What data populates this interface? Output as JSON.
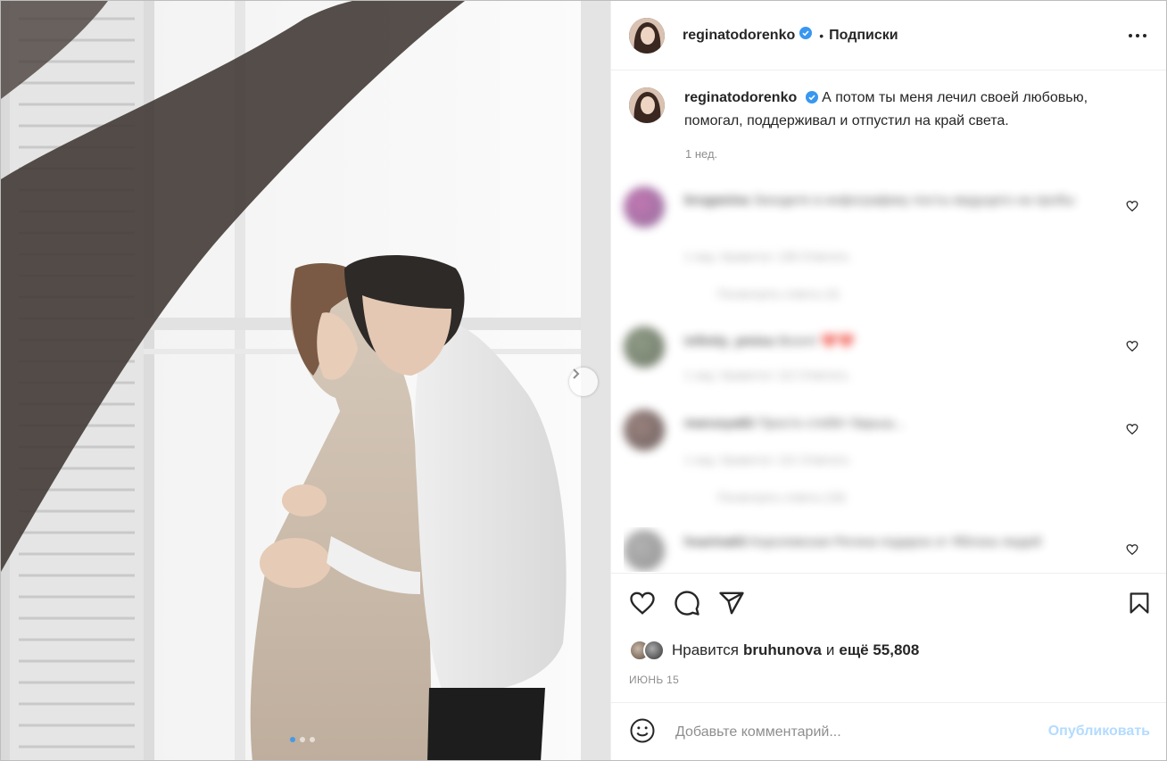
{
  "post": {
    "image_alt": "photo",
    "carousel": {
      "count": 3,
      "active_index": 0
    }
  },
  "header": {
    "username": "reginatodorenko",
    "separator": "•",
    "follow_label": "Подписки"
  },
  "caption": {
    "username": "reginatodorenko",
    "text": "А потом ты меня лечил своей любовью, помогал, поддерживал и отпустил на край света.",
    "time": "1 нед."
  },
  "comments": [
    {
      "user": "bruganina",
      "text": "Заходите в инфографику посты ведущего на пробы",
      "meta": "1 нед.   Нравится: 138   Ответить",
      "replies": "Посмотреть ответы (4)"
    },
    {
      "user": "infinity_pmisu",
      "text": "Boom! ❤️❤️",
      "meta": "1 нед.   Нравится: 112   Ответить",
      "replies": ""
    },
    {
      "user": "marusya82",
      "text": "Просто стебёт барыш...",
      "meta": "1 нед.   Нравится: 141   Ответить",
      "replies": "Посмотреть ответы (18)"
    },
    {
      "user": "hsarina63",
      "text": "Королевская Регина подарок от Яблока людей",
      "meta": "",
      "replies": ""
    }
  ],
  "likes": {
    "prefix": "Нравится",
    "user": "bruhunova",
    "conj": "и",
    "rest": "ещё 55,808"
  },
  "date": "ИЮНЬ 15",
  "add_comment": {
    "placeholder": "Добавьте комментарий...",
    "publish_label": "Опубликовать"
  },
  "colors": {
    "verified": "#3897f0",
    "publish_disabled": "#b3dbff",
    "secondary_text": "#8e8e8e"
  },
  "icons": [
    "heart-icon",
    "comment-icon",
    "share-icon",
    "bookmark-icon",
    "more-icon",
    "emoji-icon",
    "chevron-right-icon",
    "verified-icon"
  ]
}
